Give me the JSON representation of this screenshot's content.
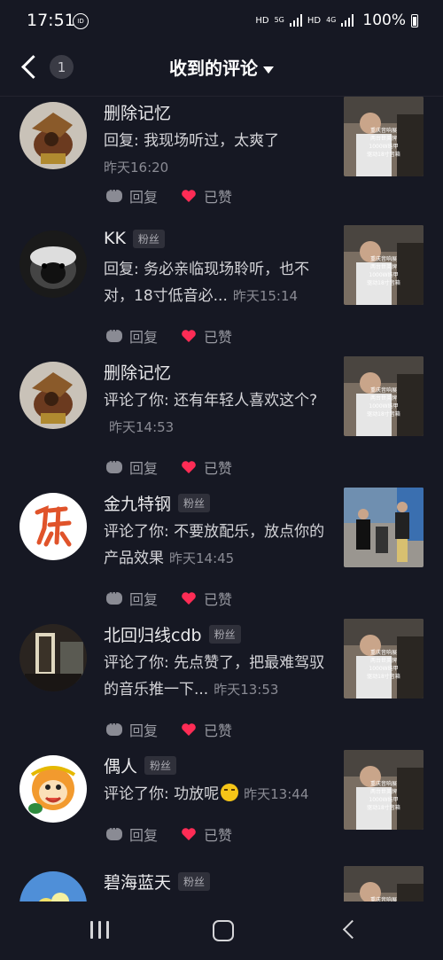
{
  "status_bar": {
    "time": "17:51",
    "net_1": "HD",
    "net_2": "5G",
    "net_3": "HD",
    "net_4": "4G",
    "battery": "100%"
  },
  "header": {
    "badge_count": "1",
    "title": "收到的评论"
  },
  "comments": [
    {
      "name": "删除记忆",
      "fan": "",
      "text": "回复: 我现场听过，太爽了",
      "time": "昨天16:20",
      "reply": "回复",
      "liked": "已赞"
    },
    {
      "name": "KK",
      "fan": "粉丝",
      "text": "回复: 务必亲临现场聆听，也不对，18寸低音必...",
      "time": "昨天15:14",
      "reply": "回复",
      "liked": "已赞"
    },
    {
      "name": "删除记忆",
      "fan": "",
      "text": "评论了你: 还有年轻人喜欢这个?",
      "time": "昨天14:53",
      "reply": "回复",
      "liked": "已赞"
    },
    {
      "name": "金九特钢",
      "fan": "粉丝",
      "text": "评论了你: 不要放配乐，放点你的产品效果",
      "time": "昨天14:45",
      "reply": "回复",
      "liked": "已赞"
    },
    {
      "name": "北回归线cdb",
      "fan": "粉丝",
      "text": "评论了你: 先点赞了，把最难驾驭的音乐推一下...",
      "time": "昨天13:53",
      "reply": "回复",
      "liked": "已赞"
    },
    {
      "name": "偶人",
      "fan": "粉丝",
      "text": "评论了你: 功放呢",
      "time": "昨天13:44",
      "reply": "回复",
      "liked": "已赞"
    },
    {
      "name": "碧海蓝天",
      "fan": "粉丝",
      "text": "",
      "time": "",
      "reply": "",
      "liked": ""
    }
  ],
  "thumb_caption": [
    "重庆音响展",
    "两台世英牌",
    "1000W纯甲",
    "驱动18寸音箱"
  ],
  "colors": {
    "background": "#161823",
    "heart": "#fe2c55",
    "muted": "#8a8b94"
  }
}
